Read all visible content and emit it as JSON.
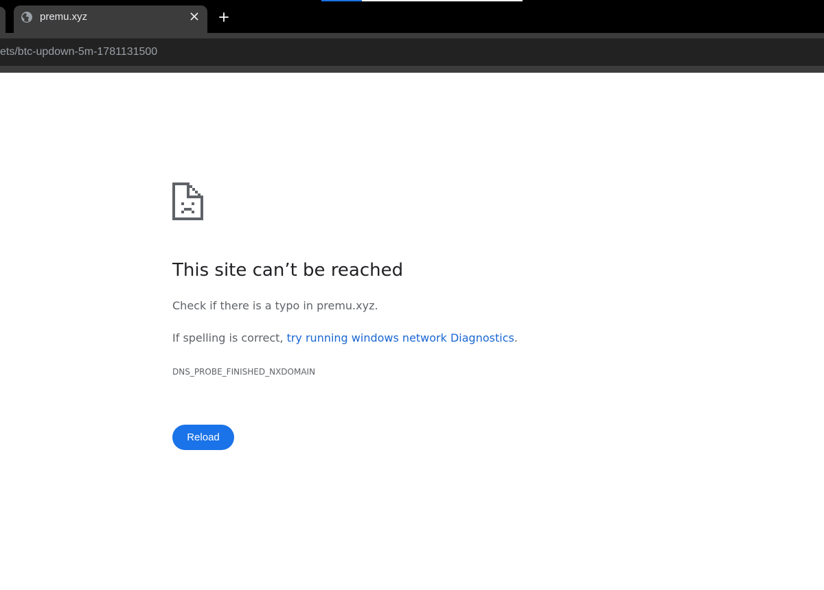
{
  "browser": {
    "tab": {
      "title": "premu.xyz",
      "favicon": "globe-icon",
      "close_icon": "close-icon"
    },
    "new_tab_icon": "plus-icon",
    "address": {
      "text": "ets/btc-updown-5m-1781131500"
    },
    "colors": {
      "tab_strip": "#000000",
      "tab_active": "#3c3c3c",
      "address_bar": "#222222"
    }
  },
  "error_page": {
    "icon": "sad-page-icon",
    "heading": "This site can’t be reached",
    "check_text": "Check if there is a typo in premu.xyz.",
    "spelling_prefix": "If spelling is correct, ",
    "diagnostics_link": "try running windows network Diagnostics",
    "spelling_suffix": ".",
    "error_code": "DNS_PROBE_FINISHED_NXDOMAIN",
    "reload_label": "Reload",
    "colors": {
      "button": "#1a73e8",
      "link": "#1967d2"
    }
  }
}
